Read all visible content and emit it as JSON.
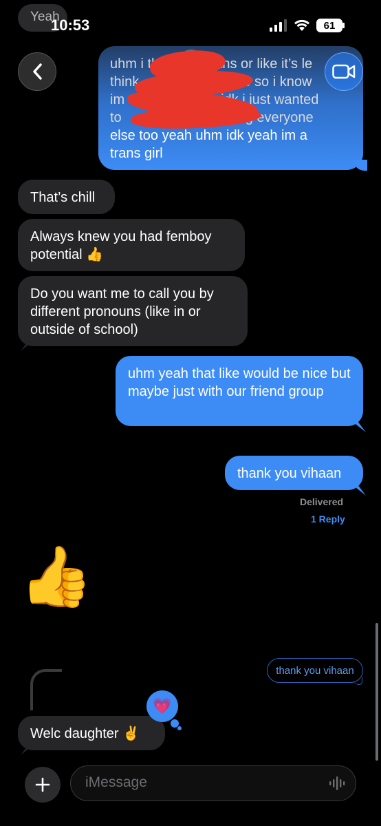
{
  "status_bar": {
    "time": "10:53",
    "battery": "61",
    "ghost_notification": "Yeah"
  },
  "icons": {
    "back": "chevron-left-icon",
    "video": "video-camera-icon",
    "signal": "cellular-signal-icon",
    "wifi": "wifi-icon",
    "battery": "battery-icon",
    "plus": "plus-icon",
    "audio": "waveform-icon"
  },
  "colors": {
    "sent_bubble": "#3d8cf5",
    "received_bubble": "#262628",
    "background": "#000000"
  },
  "messages": {
    "top_sent_partial": {
      "line1": "uhm i thi",
      "line1b": "rans or like it’s le",
      "line2": "think",
      "line2b": "d more so i know",
      "line3": "im",
      "line3b": "idk i just wanted",
      "line4": "to",
      "line4b": "g everyone",
      "line5": "else too yeah uhm idk yeah im a",
      "line6": "trans girl"
    },
    "recv_1": "That’s chill",
    "recv_2": "Always knew you had femboy potential 👍",
    "recv_3": "Do you want me to call you by different pronouns (like in or outside of school)",
    "sent_1": "uhm yeah that like would be nice but maybe just with our friend group",
    "sent_2": "thank you vihaan",
    "delivered": "Delivered",
    "reply_count": "1 Reply",
    "big_emoji": "👍",
    "quoted_message": "thank you vihaan",
    "tapback": "💗",
    "recv_reply": "Welc daughter ✌️"
  },
  "input": {
    "placeholder": "iMessage"
  }
}
